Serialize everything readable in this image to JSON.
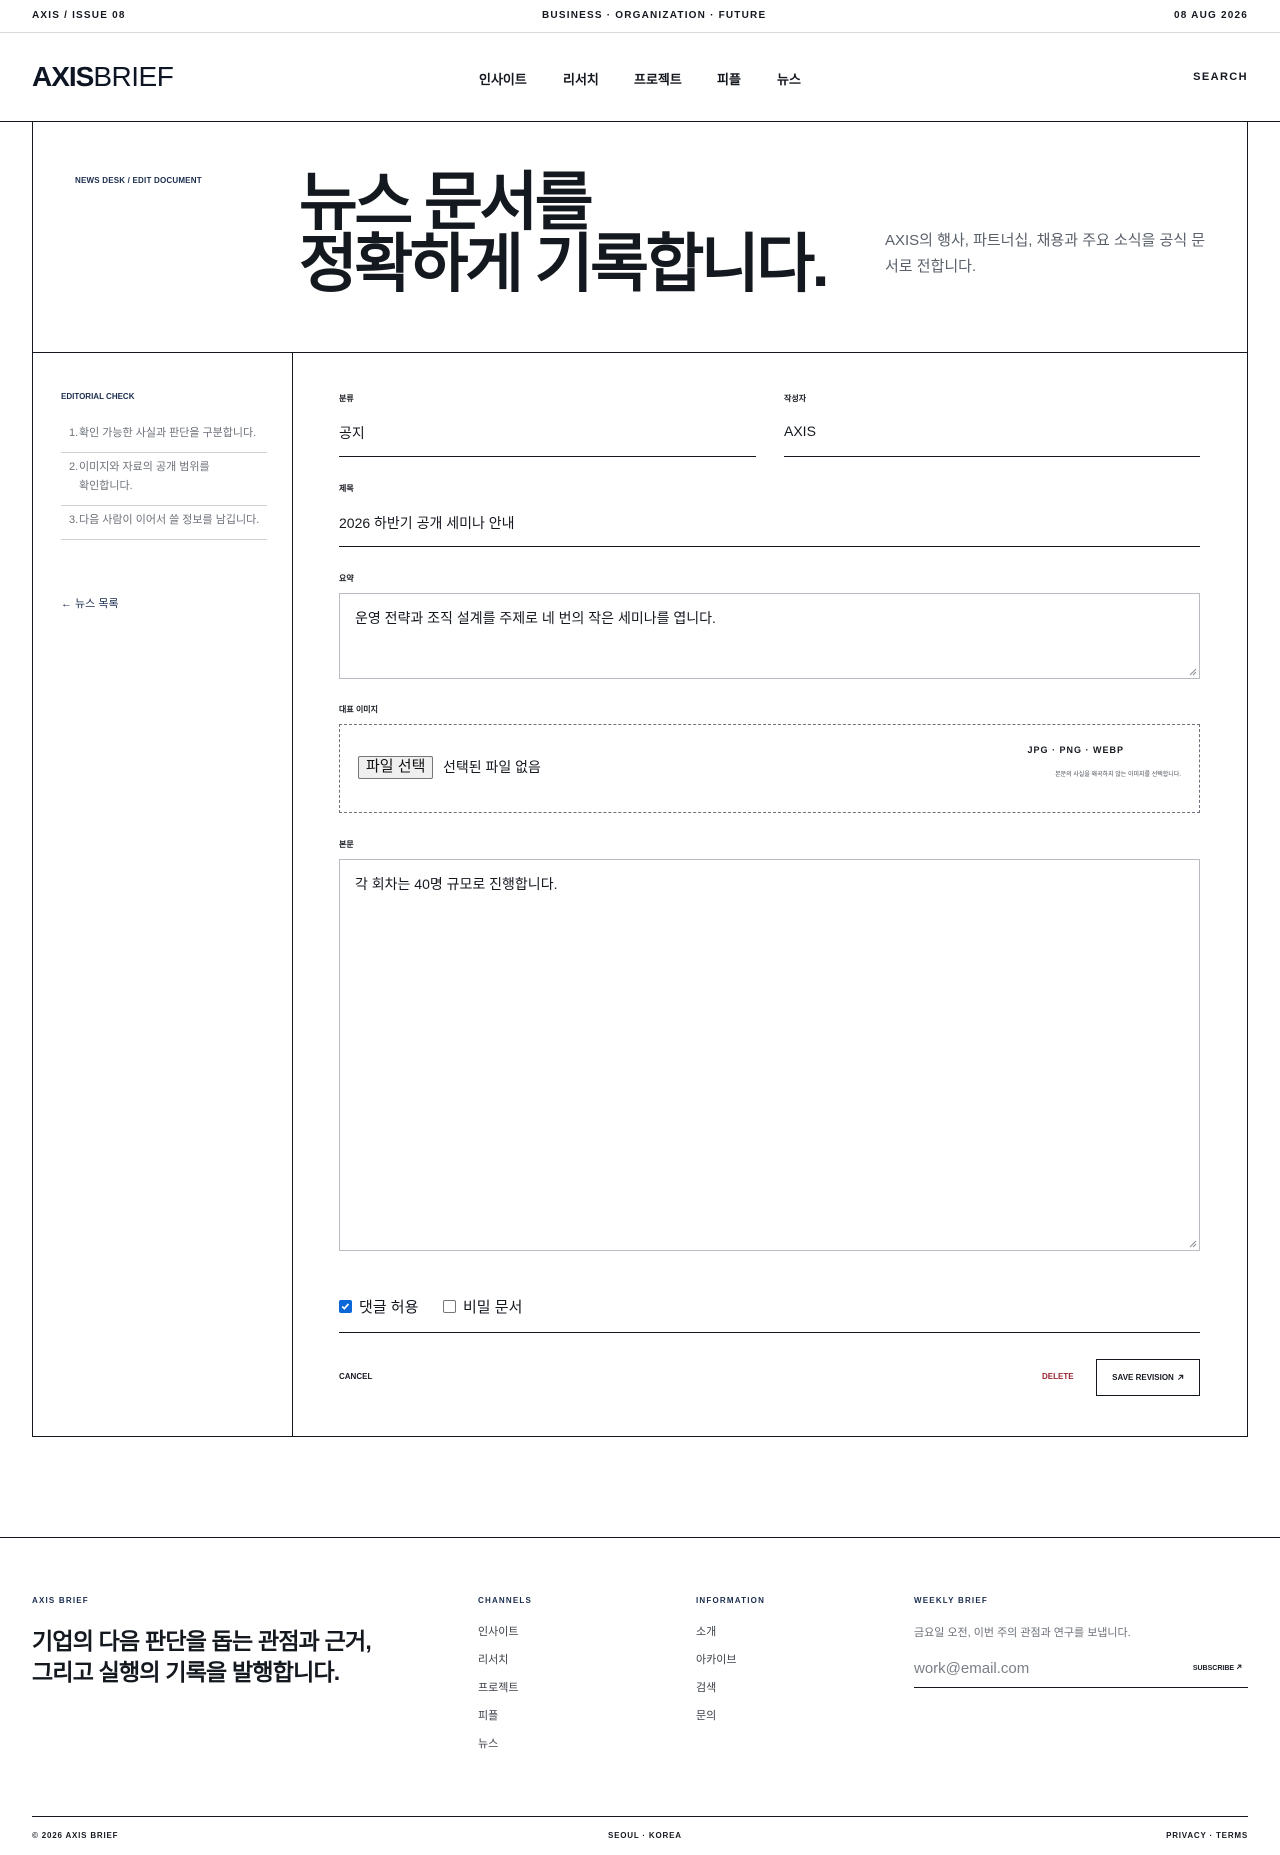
{
  "topbar": {
    "issue": "AXIS / ISSUE 08",
    "tagline": "BUSINESS · ORGANIZATION · FUTURE",
    "date": "08 AUG 2026"
  },
  "header": {
    "logo_bold": "AXIS",
    "logo_light": "BRIEF",
    "nav": [
      "인사이트",
      "리서치",
      "프로젝트",
      "피플",
      "뉴스"
    ],
    "search": "SEARCH"
  },
  "hero": {
    "kicker": "NEWS DESK / EDIT DOCUMENT",
    "title_line1": "뉴스 문서를",
    "title_line2": "정확하게 기록합니다.",
    "description": "AXIS의 행사, 파트너십, 채용과 주요 소식을 공식 문서로 전합니다."
  },
  "sidebar": {
    "check_title": "EDITORIAL CHECK",
    "items": [
      {
        "num": "1.",
        "text": "확인 가능한 사실과 판단을 구분합니다."
      },
      {
        "num": "2.",
        "text": "이미지와 자료의 공개 범위를 확인합니다."
      },
      {
        "num": "3.",
        "text": "다음 사람이 이어서 쓸 정보를 남깁니다."
      }
    ],
    "back_link": "← 뉴스 목록"
  },
  "form": {
    "category_label": "분류",
    "category_value": "공지",
    "author_label": "작성자",
    "author_value": "AXIS",
    "title_label": "제목",
    "title_value": "2026 하반기 공개 세미나 안내",
    "summary_label": "요약",
    "summary_value": "운영 전략과 조직 설계를 주제로 네 번의 작은 세미나를 엽니다.",
    "image_label": "대표 이미지",
    "file_button": "파일 선택",
    "file_status": "선택된 파일 없음",
    "file_types": "JPG · PNG · WEBP",
    "file_hint": "본문의 사실을 왜곡하지 않는 이미지를 선택합니다.",
    "body_label": "본문",
    "body_value": "각 회차는 40명 규모로 진행합니다.",
    "allow_comments_label": "댓글 허용",
    "allow_comments": true,
    "secret_label": "비밀 문서",
    "secret": false,
    "cancel": "CANCEL",
    "delete": "DELETE",
    "save": "SAVE REVISION",
    "save_icon": "arrow-up-right-icon"
  },
  "footer": {
    "brand": "AXIS BRIEF",
    "tagline_line1": "기업의 다음 판단을 돕는 관점과 근거,",
    "tagline_line2": "그리고 실행의 기록을 발행합니다.",
    "channels_title": "CHANNELS",
    "channels": [
      "인사이트",
      "리서치",
      "프로젝트",
      "피플",
      "뉴스"
    ],
    "info_title": "INFORMATION",
    "info": [
      "소개",
      "아카이브",
      "검색",
      "문의"
    ],
    "newsletter_title": "WEEKLY BRIEF",
    "newsletter_desc": "금요일 오전, 이번 주의 관점과 연구를 보냅니다.",
    "email_placeholder": "work@email.com",
    "subscribe": "SUBSCRIBE",
    "copyright": "© 2026 AXIS BRIEF",
    "location": "SEOUL · KOREA",
    "legal": "PRIVACY · TERMS"
  },
  "colors": {
    "ink": "#14181f",
    "navy": "#1a2c4e",
    "delete": "#9a2331",
    "checkbox": "#0b67d8"
  }
}
